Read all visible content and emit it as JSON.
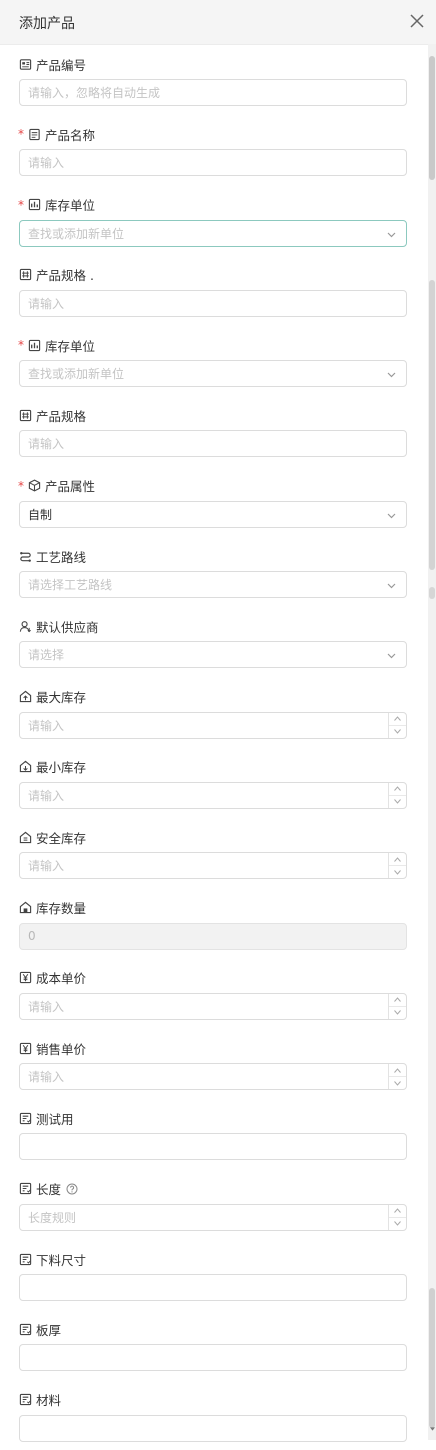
{
  "dialog": {
    "title": "添加产品",
    "close_icon": "close-icon"
  },
  "fields": [
    {
      "label": "产品编号",
      "required": false,
      "icon": "id-card-icon",
      "type": "text",
      "placeholder": "请输入，忽略将自动生成",
      "value": ""
    },
    {
      "label": "产品名称",
      "required": true,
      "icon": "document-icon",
      "type": "text",
      "placeholder": "请输入",
      "value": ""
    },
    {
      "label": "库存单位",
      "required": true,
      "icon": "bar-chart-icon",
      "type": "select",
      "placeholder": "查找或添加新单位",
      "value": "",
      "focused": true
    },
    {
      "label": "产品规格 .",
      "required": false,
      "icon": "grid-icon",
      "type": "text",
      "placeholder": "请输入",
      "value": ""
    },
    {
      "label": "库存单位",
      "required": true,
      "icon": "bar-chart-icon",
      "type": "select",
      "placeholder": "查找或添加新单位",
      "value": ""
    },
    {
      "label": "产品规格",
      "required": false,
      "icon": "grid-icon",
      "type": "text",
      "placeholder": "请输入",
      "value": ""
    },
    {
      "label": "产品属性",
      "required": true,
      "icon": "cube-icon",
      "type": "select",
      "placeholder": "",
      "value": "自制"
    },
    {
      "label": "工艺路线",
      "required": false,
      "icon": "route-icon",
      "type": "select",
      "placeholder": "请选择工艺路线",
      "value": ""
    },
    {
      "label": "默认供应商",
      "required": false,
      "icon": "user-icon",
      "type": "select",
      "placeholder": "请选择",
      "value": ""
    },
    {
      "label": "最大库存",
      "required": false,
      "icon": "warehouse-up-icon",
      "type": "number",
      "placeholder": "请输入",
      "value": ""
    },
    {
      "label": "最小库存",
      "required": false,
      "icon": "warehouse-down-icon",
      "type": "number",
      "placeholder": "请输入",
      "value": ""
    },
    {
      "label": "安全库存",
      "required": false,
      "icon": "warehouse-shield-icon",
      "type": "number",
      "placeholder": "请输入",
      "value": ""
    },
    {
      "label": "库存数量",
      "required": false,
      "icon": "warehouse-icon",
      "type": "disabled",
      "placeholder": "",
      "value": "0"
    },
    {
      "label": "成本单价",
      "required": false,
      "icon": "yen-icon",
      "type": "number",
      "placeholder": "请输入",
      "value": ""
    },
    {
      "label": "销售单价",
      "required": false,
      "icon": "yen-icon",
      "type": "number",
      "placeholder": "请输入",
      "value": ""
    },
    {
      "label": "测试用",
      "required": false,
      "icon": "form-icon",
      "type": "text",
      "placeholder": "",
      "value": ""
    },
    {
      "label": "长度",
      "required": false,
      "icon": "form-icon",
      "type": "number",
      "placeholder": "长度规则",
      "value": "",
      "help": true
    },
    {
      "label": "下料尺寸",
      "required": false,
      "icon": "form-icon",
      "type": "text",
      "placeholder": "",
      "value": ""
    },
    {
      "label": "板厚",
      "required": false,
      "icon": "form-icon",
      "type": "text",
      "placeholder": "",
      "value": ""
    },
    {
      "label": "材料",
      "required": false,
      "icon": "form-icon",
      "type": "text",
      "placeholder": "",
      "value": ""
    }
  ],
  "colors": {
    "required": "#e54545",
    "focus_border": "#8cc9bf",
    "placeholder": "#c4c4c4"
  }
}
